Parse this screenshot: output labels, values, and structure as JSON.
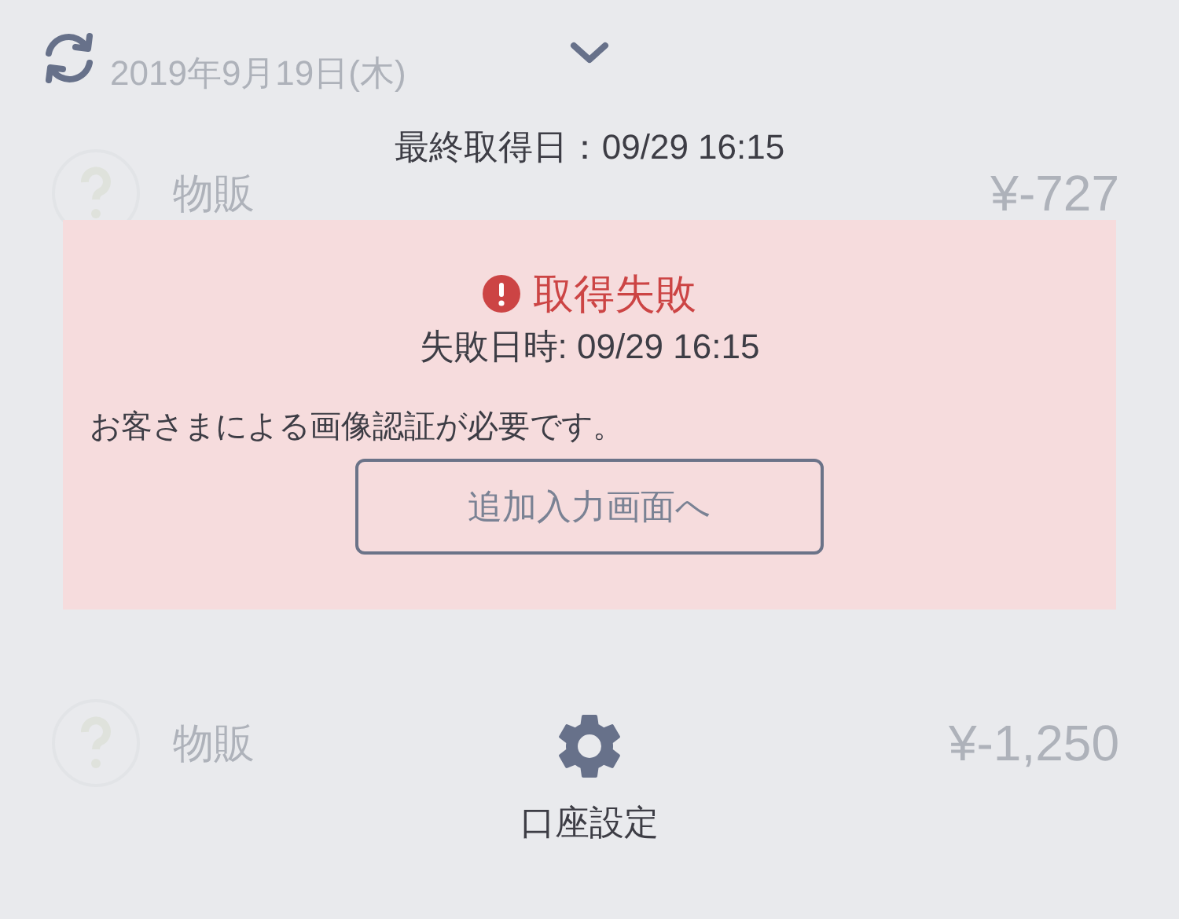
{
  "background_list": {
    "date_header": "2019年9月19日(木)",
    "rows": [
      {
        "name": "物販",
        "amount": "¥-727"
      },
      {
        "name": "物販",
        "amount": "¥-1,250"
      }
    ]
  },
  "header": {
    "last_fetched": "最終取得日：09/29 16:15"
  },
  "error_panel": {
    "title": "取得失敗",
    "failed_at": "失敗日時: 09/29 16:15",
    "message": "お客さまによる画像認証が必要です。",
    "button": "追加入力画面へ"
  },
  "account_settings": {
    "label": "口座設定"
  }
}
